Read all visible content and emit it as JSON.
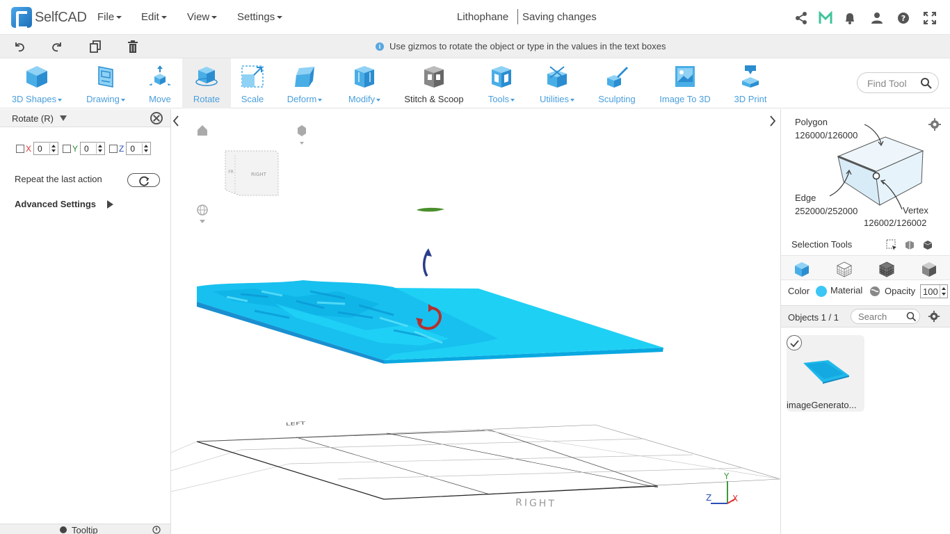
{
  "app": {
    "name": "SelfCAD"
  },
  "menu": {
    "file": "File",
    "edit": "Edit",
    "view": "View",
    "settings": "Settings"
  },
  "document": {
    "title": "Lithophane",
    "status": "Saving changes"
  },
  "topbar_icons": [
    "share-icon",
    "m-logo-icon",
    "bell-icon",
    "user-icon",
    "help-icon",
    "fullscreen-icon"
  ],
  "subbar": {
    "hint": "Use gizmos to rotate the object or type in the values in the text boxes",
    "icons": [
      "undo-icon",
      "redo-icon",
      "copy-icon",
      "delete-icon"
    ]
  },
  "toolbar": {
    "items": [
      {
        "label": "3D Shapes",
        "dropdown": true
      },
      {
        "label": "Drawing",
        "dropdown": true
      },
      {
        "label": "Move",
        "dropdown": false
      },
      {
        "label": "Rotate",
        "dropdown": false,
        "active": true
      },
      {
        "label": "Scale",
        "dropdown": false
      },
      {
        "label": "Deform",
        "dropdown": true
      },
      {
        "label": "Modify",
        "dropdown": true
      },
      {
        "label": "Stitch & Scoop",
        "dropdown": false
      },
      {
        "label": "Tools",
        "dropdown": true
      },
      {
        "label": "Utilities",
        "dropdown": true
      },
      {
        "label": "Sculpting",
        "dropdown": false
      },
      {
        "label": "Image To 3D",
        "dropdown": false
      },
      {
        "label": "3D Print",
        "dropdown": false
      }
    ],
    "find_placeholder": "Find Tool"
  },
  "left_panel": {
    "title": "Rotate (R)",
    "axes": [
      {
        "label": "X",
        "value": "0",
        "color": "#d33"
      },
      {
        "label": "Y",
        "value": "0",
        "color": "#2a8a2a"
      },
      {
        "label": "Z",
        "value": "0",
        "color": "#2b4fb5"
      }
    ],
    "repeat_label": "Repeat the last action",
    "advanced_label": "Advanced Settings",
    "tooltip_label": "Tooltip"
  },
  "viewport": {
    "cube_face_right": "RIGHT",
    "cube_face_left": "FR",
    "grid_label_back": "LEFT",
    "grid_label_front": "RIGHT",
    "axis_x": "X",
    "axis_y": "Y",
    "axis_z": "Z"
  },
  "right_panel": {
    "polygon_label": "Polygon",
    "polygon_count": "126000/126000",
    "edge_label": "Edge",
    "edge_count": "252000/252000",
    "vertex_label": "Vertex",
    "vertex_count": "126002/126002",
    "selection_tools_label": "Selection Tools",
    "color_label": "Color",
    "material_label": "Material",
    "opacity_label": "Opacity",
    "opacity_value": "100",
    "objects_label": "Objects 1 / 1",
    "search_placeholder": "Search",
    "object_name": "imageGenerato..."
  },
  "colors": {
    "accent": "#4a9fdc",
    "model": "#1fd0f5",
    "model_dark": "#0aa8e0",
    "object_color": "#3cc6f5"
  }
}
